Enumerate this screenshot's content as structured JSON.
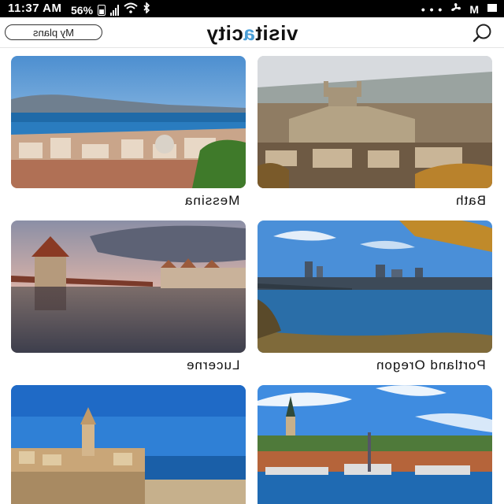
{
  "status_bar": {
    "time": "11:37 AM",
    "battery": "56%",
    "icons": [
      "bluetooth-icon",
      "wifi-icon",
      "signal-icon",
      "battery-icon",
      "mail-icon",
      "fan-icon",
      "more-dots-icon"
    ]
  },
  "header": {
    "my_plans_label": "My plans",
    "logo_text_pre": "visit",
    "logo_text_accent": "a",
    "logo_text_post": "city",
    "search_icon": "search-icon"
  },
  "cities": [
    {
      "name": "Messina",
      "scene": "coast"
    },
    {
      "name": "Bath",
      "scene": "abbey"
    },
    {
      "name": "Lucerne",
      "scene": "lake"
    },
    {
      "name": "Portland Oregon",
      "scene": "river"
    },
    {
      "name": "",
      "scene": "fortress"
    },
    {
      "name": "",
      "scene": "harbor"
    }
  ],
  "colors": {
    "accent": "#4b9fd8",
    "status_bar_bg": "#000000",
    "text": "#111111"
  }
}
